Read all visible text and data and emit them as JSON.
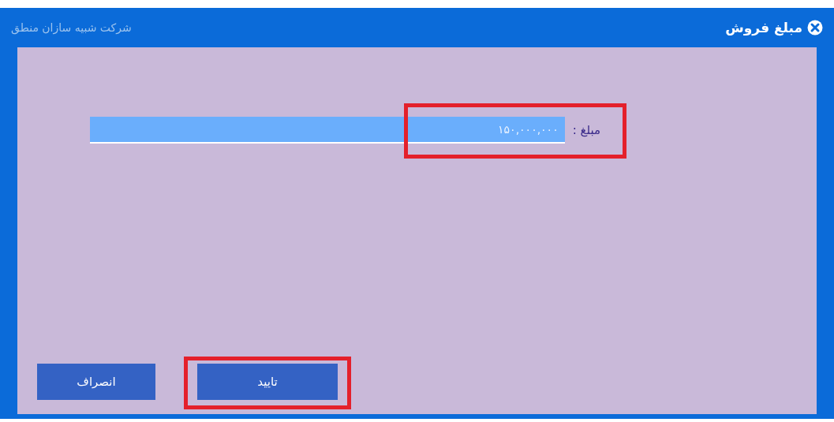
{
  "window": {
    "title": "مبلغ فروش",
    "company": "شرکت شبیه سازان منطق"
  },
  "amount_field": {
    "label": "مبلغ :",
    "value": "۱۵۰,۰۰۰,۰۰۰",
    "highlighted": true
  },
  "buttons": [
    {
      "label": "تایید",
      "kind": "primary",
      "highlighted": true
    },
    {
      "label": "انصراف",
      "kind": "secondary",
      "highlighted": false
    }
  ]
}
